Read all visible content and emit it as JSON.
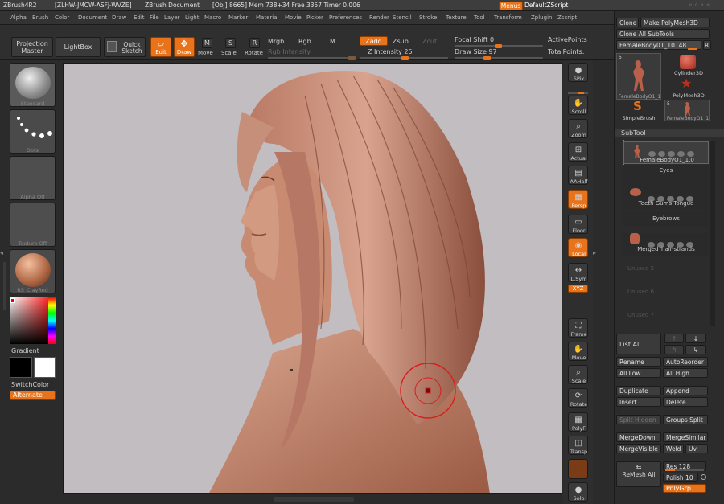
{
  "titlebar": {
    "app": "ZBrush4R2",
    "id": "[ZLHW-JMCW-ASFJ-WVZE]",
    "doc": "ZBrush Document",
    "stats": "[Obj] 8665]  Mem 738+34  Free 3357  Timer 0.006",
    "menus_btn": "Menus",
    "script_btn": "DefaultZScript"
  },
  "menubar": [
    "Alpha",
    "Brush",
    "Color",
    "Document",
    "Draw",
    "Edit",
    "File",
    "Layer",
    "Light",
    "Macro",
    "Marker",
    "Material",
    "Movie",
    "Picker",
    "Preferences",
    "Render",
    "Stencil",
    "Stroke",
    "Texture",
    "Tool",
    "Transform",
    "Zplugin",
    "Zscript"
  ],
  "shelf": {
    "projection_master": "Projection Master",
    "lightbox": "LightBox",
    "quick_sketch": "Quick Sketch",
    "edit": "Edit",
    "draw": "Draw",
    "move": "Move",
    "scale": "Scale",
    "rotate": "Rotate",
    "mrgb": "Mrgb",
    "rgb": "Rgb",
    "m": "M",
    "rgb_intensity": "Rgb Intensity",
    "zadd": "Zadd",
    "zsub": "Zsub",
    "zcut": "Zcut",
    "z_intensity": "Z Intensity 25",
    "focal_shift": "Focal Shift 0",
    "draw_size": "Draw Size 97",
    "active_points": "ActivePoints",
    "total_points": "TotalPoints:"
  },
  "lefttray": {
    "standard": "Standard",
    "dots": "Dots",
    "alpha_off": "Alpha Off",
    "texture_off": "Texture Off",
    "material": "RS_ClayRed",
    "gradient": "Gradient",
    "switch_color": "SwitchColor",
    "alternate": "Alternate"
  },
  "righttool": [
    "SPix",
    "Scroll",
    "Zoom",
    "Actual",
    "AAHalf",
    "Persp",
    "Floor",
    "Local",
    "L.Sym",
    "XYZ",
    "Frame",
    "Move",
    "Scale",
    "Rotate",
    "PolyF",
    "Transp",
    "Solo"
  ],
  "rpanel": {
    "clone": "Clone",
    "make_polymesh": "Make PolyMesh3D",
    "clone_all": "Clone All SubTools",
    "active_tool": "FemaleBody01_10. 48",
    "r": "R",
    "tools": [
      "FemaleBodyO1_1",
      "Cylinder3D",
      "PolyMesh3D",
      "SimpleBrush",
      "FemaleBodyO1_1"
    ],
    "tool_count": "5",
    "subtool_header": "SubTool",
    "subtools": [
      "FemaleBodyO1_1.0",
      "Eyes",
      "Teeth Gums Tongue",
      "Eyebrows",
      "Merged_hair-strands",
      "Unused 5",
      "Unused 6",
      "Unused 7"
    ],
    "list_all": "List All",
    "rename": "Rename",
    "autoreorder": "AutoReorder",
    "all_low": "All Low",
    "all_high": "All High",
    "duplicate": "Duplicate",
    "append": "Append",
    "insert": "Insert",
    "delete": "Delete",
    "split_hidden": "Split Hidden",
    "groups_split": "Groups Split",
    "mergedown": "MergeDown",
    "mergesimilar": "MergeSimilar",
    "mergevisible": "MergeVisible",
    "weld": "Weld",
    "uv": "Uv",
    "remesh_all": "ReMesh All",
    "res": "Res 128",
    "polish": "Polish 10",
    "polygrp": "PolyGrp"
  }
}
